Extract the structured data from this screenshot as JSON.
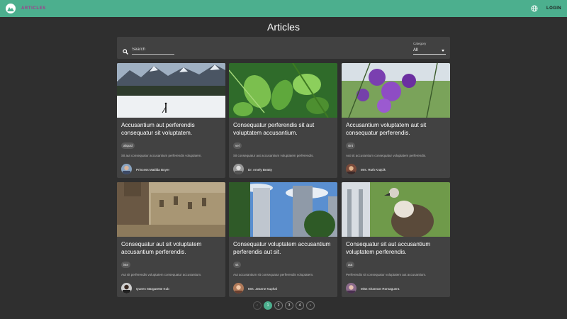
{
  "app": {
    "nav_link": "ARTICLES",
    "login_label": "LOGIN"
  },
  "page": {
    "title": "Articles"
  },
  "filters": {
    "search_placeholder": "Search",
    "category_label": "Category",
    "category_value": "All"
  },
  "articles": [
    {
      "title": "Accusantium aut perferendis consequatur sit voluptatem.",
      "tag": "aliquid",
      "excerpt": "Sit aut consequatur accusantium perferendis voluptatem.",
      "author": "Princess Matilda Boyer"
    },
    {
      "title": "Consequatur perferendis sit aut voluptatem accusantium.",
      "tag": "vel",
      "excerpt": "Sit consequatur aut accusantium voluptatem perferendis.",
      "author": "Dr. Amely Beatty"
    },
    {
      "title": "Accusantium voluptatem aut sit consequatur perferendis.",
      "tag": "sint",
      "excerpt": "Aut sit accusantium consequatur voluptatem perferendis.",
      "author": "Mrs. Ruth Krajcik"
    },
    {
      "title": "Consequatur aut sit voluptatem accusantium perferendis.",
      "tag": "iste",
      "excerpt": "Aut sit perferendis voluptatem consequatur accusantium.",
      "author": "Queen Margarette Kub"
    },
    {
      "title": "Consequatur voluptatem accusantium perferendis aut sit.",
      "tag": "sit",
      "excerpt": "Aut accusantium sit consequatur perferendis voluptatem.",
      "author": "Mrs. Jeanne Kuphal"
    },
    {
      "title": "Consequatur sit aut accusantium voluptatem perferendis.",
      "tag": "aut",
      "excerpt": "Perferendis sit consequatur voluptatem aut accusantium.",
      "author": "Miss Shannon Romaguera"
    }
  ],
  "pagination": {
    "prev": "‹",
    "pages": [
      "1",
      "2",
      "3",
      "4"
    ],
    "next": "›",
    "current": "1"
  },
  "colors": {
    "appbar": "#4caf8e",
    "nav_link": "#a33a8e",
    "background": "#2f2f2f",
    "card": "#424242"
  },
  "icons": {
    "logo": "logo-icon",
    "language": "globe-icon",
    "search": "search-icon",
    "category": "chevron-down-icon"
  }
}
